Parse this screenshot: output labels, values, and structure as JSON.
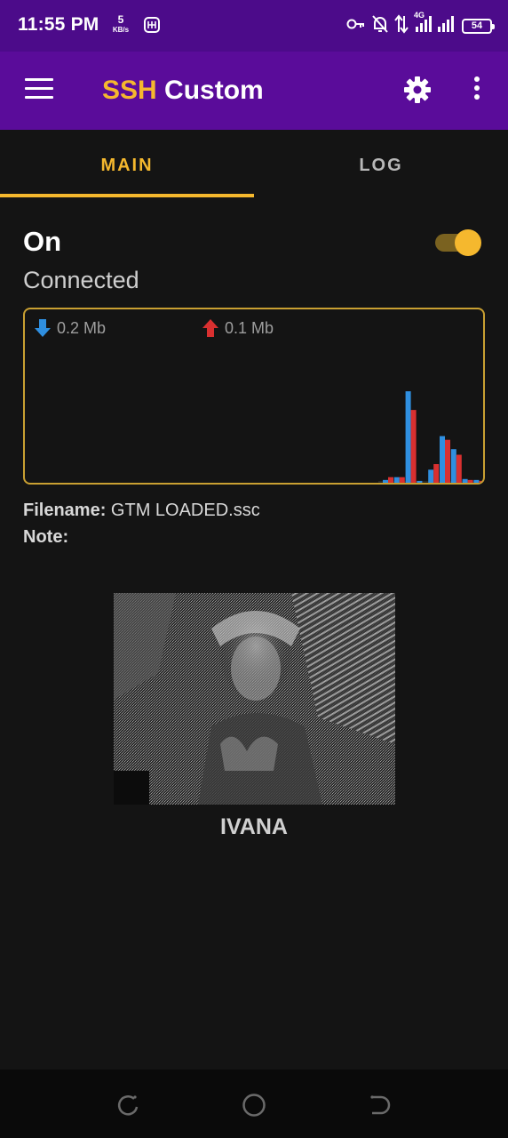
{
  "status_bar": {
    "time": "11:55 PM",
    "net_speed_value": "5",
    "net_speed_unit": "KB/s",
    "network": "4G",
    "battery": "54",
    "icons": [
      "vpn-icon",
      "key-icon",
      "notifications-off-icon",
      "data-arrows-icon",
      "signal-icon",
      "battery-icon"
    ]
  },
  "app_bar": {
    "title_accent": "SSH",
    "title_rest": " Custom",
    "accent_color": "#f5b82e",
    "bar_color": "#5a0c9a"
  },
  "tabs": [
    {
      "label": "MAIN",
      "selected": true
    },
    {
      "label": "LOG",
      "selected": false
    }
  ],
  "connection": {
    "state": "On",
    "status": "Connected",
    "toggle_on": true
  },
  "traffic": {
    "download_label": "0.2 Mb",
    "upload_label": "0.1 Mb",
    "download_color": "#2f8fe0",
    "upload_color": "#d93030",
    "download_series": [
      0.03,
      0.06,
      0.98,
      0.02,
      0.14,
      0.5,
      0.36,
      0.04,
      0.03
    ],
    "upload_series": [
      0.06,
      0.06,
      0.78,
      0.0,
      0.2,
      0.46,
      0.3,
      0.03,
      0.02
    ]
  },
  "config": {
    "filename_label": "Filename:",
    "filename_value": "GTM LOADED.ssc",
    "note_label": "Note:",
    "note_value": ""
  },
  "banner": {
    "caption": "IVANA"
  },
  "nav": {
    "icons": [
      "recent-apps-icon",
      "home-icon",
      "back-icon"
    ]
  }
}
